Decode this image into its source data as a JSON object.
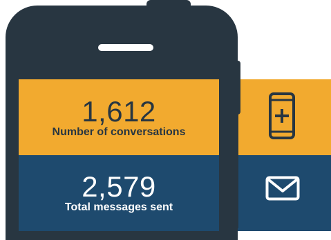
{
  "stats": [
    {
      "value": "1,612",
      "label": "Number of conversations"
    },
    {
      "value": "2,579",
      "label": "Total messages sent"
    }
  ],
  "colors": {
    "phone": "#283641",
    "orange": "#f2aa2f",
    "blue": "#1e4a6e"
  },
  "icons": [
    "phone-plus-icon",
    "envelope-icon"
  ]
}
